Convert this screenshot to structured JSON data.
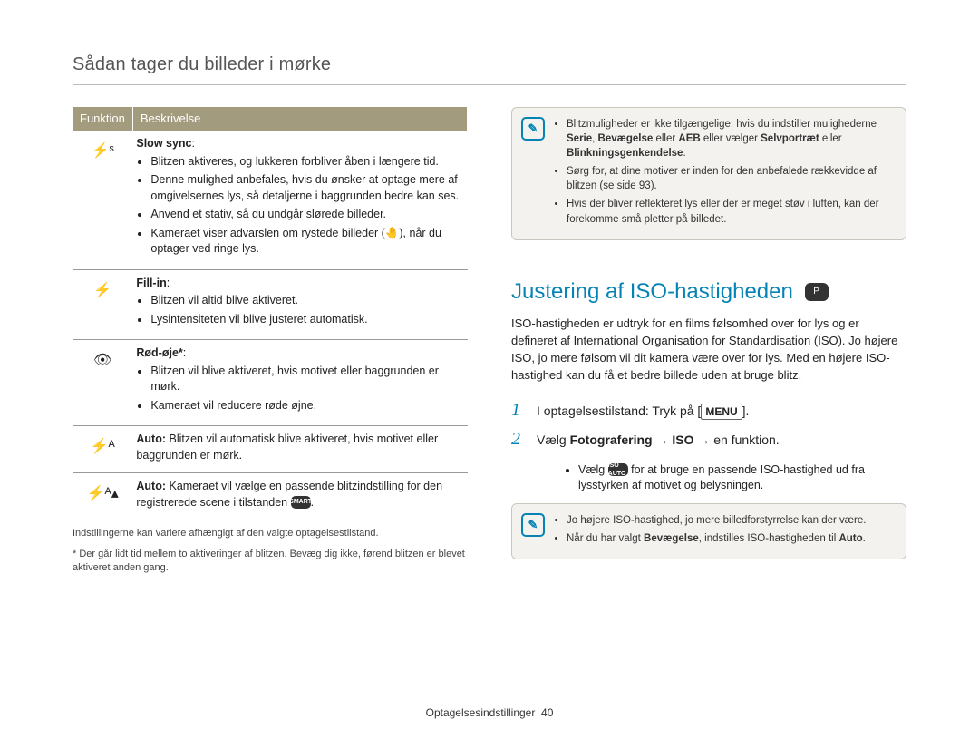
{
  "running_head": "Sådan tager du billeder i mørke",
  "left": {
    "table_headers": [
      "Funktion",
      "Beskrivelse"
    ],
    "rows": [
      {
        "icon_glyph": "⚡ˢ",
        "title": "Slow sync",
        "bullets": [
          "Blitzen aktiveres, og lukkeren forbliver åben i længere tid.",
          "Denne mulighed anbefales, hvis du ønsker at optage mere af omgivelsernes lys, så detaljerne i baggrunden bedre kan ses.",
          "Anvend et stativ, så du undgår slørede billeder.",
          "Kameraet viser advarslen om rystede billeder (🤚), når du optager ved ringe lys."
        ]
      },
      {
        "icon_glyph": "⚡",
        "title": "Fill-in",
        "bullets": [
          "Blitzen vil altid blive aktiveret.",
          "Lysintensiteten vil blive justeret automatisk."
        ]
      },
      {
        "icon_glyph": "👁",
        "title": "Rød-øje*",
        "bullets": [
          "Blitzen vil blive aktiveret, hvis motivet eller baggrunden er mørk.",
          "Kameraet vil reducere røde øjne."
        ]
      },
      {
        "icon_glyph": "⚡ᴬ",
        "title": "",
        "plain_prefix": "Auto: ",
        "plain_text": "Blitzen vil automatisk blive aktiveret, hvis motivet eller baggrunden er mørk."
      },
      {
        "icon_glyph": "⚡ᴬ▴",
        "title": "",
        "plain_prefix": "Auto: ",
        "plain_text": "Kameraet vil vælge en passende blitzindstilling for den registrerede scene i tilstanden ",
        "trailing_icon_label": "SMART"
      }
    ],
    "footnote1": "Indstillingerne kan variere afhængigt af den valgte optagelsestilstand.",
    "footnote2": "* Der går lidt tid mellem to aktiveringer af blitzen. Bevæg dig ikke, førend blitzen er blevet aktiveret anden gang."
  },
  "right": {
    "top_note_bullets": [
      {
        "text": "Blitzmuligheder er ikke tilgængelige, hvis du indstiller mulighederne ",
        "bold1": "Serie",
        "mid": ", ",
        "bold2": "Bevægelse",
        "mid2": " eller ",
        "bold3": "AEB",
        "mid3": " eller vælger ",
        "bold4": "Selvportræt",
        "mid4": " eller ",
        "bold5": "Blinkningsgenkendelse",
        "end": "."
      },
      {
        "text": "Sørg for, at dine motiver er inden for den anbefalede rækkevidde af blitzen (se side 93)."
      },
      {
        "text": "Hvis der bliver reflekteret lys eller der er meget støv i luften, kan der forekomme små pletter på billedet."
      }
    ],
    "section_title": "Justering af ISO-hastigheden",
    "mode_icon_label": "P",
    "body_para": "ISO-hastigheden er udtryk for en films følsomhed over for lys og er defineret af International Organisation for Standardisation (ISO). Jo højere ISO, jo mere følsom vil dit kamera være over for lys. Med en højere ISO-hastighed kan du få et bedre billede uden at bruge blitz.",
    "step1_prefix": "I optagelsestilstand: Tryk på [",
    "step1_button": "MENU",
    "step1_suffix": "].",
    "step2_prefix": "Vælg ",
    "step2_bold1": "Fotografering",
    "step2_arrow1": " → ",
    "step2_bold2": "ISO",
    "step2_arrow2": " → ",
    "step2_suffix": "en funktion.",
    "step2_sub_bullet_prefix": "Vælg ",
    "step2_sub_icon_label": "ISO AUTO",
    "step2_sub_bullet_suffix": " for at bruge en passende ISO-hastighed ud fra lysstyrken af motivet og belysningen.",
    "bottom_note_bullets": [
      {
        "text": "Jo højere ISO-hastighed, jo mere billedforstyrrelse kan der være."
      },
      {
        "prefix": "Når du har valgt ",
        "bold": "Bevægelse",
        "mid": ", indstilles ISO-hastigheden til ",
        "bold2": "Auto",
        "end": "."
      }
    ]
  },
  "footer": {
    "label": "Optagelsesindstillinger",
    "page_no": "40"
  }
}
